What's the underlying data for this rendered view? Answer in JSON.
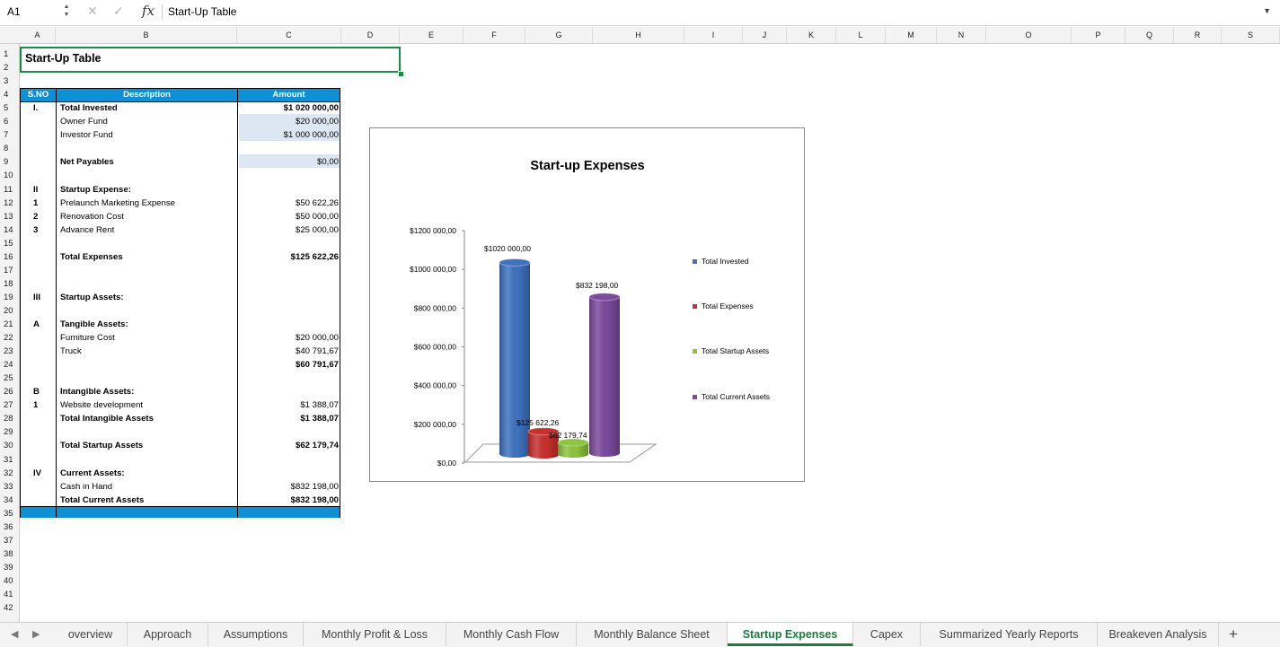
{
  "formula_bar": {
    "name_box": "A1",
    "fx": "fx",
    "formula": "Start-Up Table"
  },
  "columns": [
    "A",
    "B",
    "C",
    "D",
    "E",
    "F",
    "G",
    "H",
    "I",
    "J",
    "K",
    "L",
    "M",
    "N",
    "O",
    "P",
    "Q",
    "R",
    "S"
  ],
  "rows": [
    "1",
    "2",
    "3",
    "4",
    "5",
    "6",
    "7",
    "8",
    "9",
    "10",
    "11",
    "12",
    "13",
    "14",
    "15",
    "16",
    "17",
    "18",
    "19",
    "20",
    "21",
    "22",
    "23",
    "24",
    "25",
    "26",
    "27",
    "28",
    "29",
    "30",
    "31",
    "32",
    "33",
    "34",
    "35",
    "36",
    "37",
    "38",
    "39",
    "40",
    "41",
    "42"
  ],
  "title": "Start-Up Table",
  "table": {
    "headers": {
      "sno": "S.NO",
      "description": "Description",
      "amount": "Amount"
    },
    "rows": [
      {
        "row": 5,
        "sno": "I.",
        "desc": "Total Invested",
        "amount": "$1 020 000,00",
        "bold": true
      },
      {
        "row": 6,
        "sno": "",
        "desc": "Owner Fund",
        "amount": "$20 000,00",
        "bold": false,
        "shaded": true
      },
      {
        "row": 7,
        "sno": "",
        "desc": "Investor Fund",
        "amount": "$1 000 000,00",
        "bold": false,
        "shaded": true
      },
      {
        "row": 9,
        "sno": "",
        "desc": "Net Payables",
        "amount": "$0,00",
        "bold": true,
        "amount_bold": false,
        "shaded": true
      },
      {
        "row": 11,
        "sno": "II",
        "desc": "Startup Expense:",
        "amount": "",
        "bold": true
      },
      {
        "row": 12,
        "sno": "1",
        "desc": "Prelaunch Marketing Expense",
        "amount": "$50 622,26",
        "bold": false
      },
      {
        "row": 13,
        "sno": "2",
        "desc": "Renovation Cost",
        "amount": "$50 000,00",
        "bold": false
      },
      {
        "row": 14,
        "sno": "3",
        "desc": "Advance Rent",
        "amount": "$25 000,00",
        "bold": false
      },
      {
        "row": 16,
        "sno": "",
        "desc": "Total Expenses",
        "amount": "$125 622,26",
        "bold": true
      },
      {
        "row": 19,
        "sno": "III",
        "desc": "Startup Assets:",
        "amount": "",
        "bold": true
      },
      {
        "row": 21,
        "sno": "A",
        "desc": "Tangible Assets:",
        "amount": "",
        "bold": true
      },
      {
        "row": 22,
        "sno": "",
        "desc": "Furniture Cost",
        "amount": "$20 000,00",
        "bold": false
      },
      {
        "row": 23,
        "sno": "",
        "desc": "Truck",
        "amount": "$40 791,67",
        "bold": false
      },
      {
        "row": 24,
        "sno": "",
        "desc": "",
        "amount": "$60 791,67",
        "bold": true
      },
      {
        "row": 26,
        "sno": "B",
        "desc": "Intangible Assets:",
        "amount": "",
        "bold": true
      },
      {
        "row": 27,
        "sno": "1",
        "desc": "Website development",
        "amount": "$1 388,07",
        "bold": false
      },
      {
        "row": 28,
        "sno": "",
        "desc": "Total Intangible Assets",
        "amount": "$1 388,07",
        "bold": true
      },
      {
        "row": 30,
        "sno": "",
        "desc": "Total Startup  Assets",
        "amount": "$62 179,74",
        "bold": true
      },
      {
        "row": 32,
        "sno": "IV",
        "desc": "Current Assets:",
        "amount": "",
        "bold": true
      },
      {
        "row": 33,
        "sno": "",
        "desc": "Cash in Hand",
        "amount": "$832 198,00",
        "bold": false
      },
      {
        "row": 34,
        "sno": "",
        "desc": "Total Current Assets",
        "amount": "$832 198,00",
        "bold": true
      }
    ]
  },
  "chart_data": {
    "type": "bar",
    "title": "Start-up Expenses",
    "categories": [
      "Total Invested",
      "Total Expenses",
      "Total Startup  Assets",
      "Total Current Assets"
    ],
    "values": [
      1020000,
      125622.26,
      62179.74,
      832198
    ],
    "data_labels": [
      "$1020 000,00",
      "$125 622,26",
      "$62 179,74",
      "$832 198,00"
    ],
    "colors": [
      "#3f72c0",
      "#c8302f",
      "#8cc63f",
      "#7d4a9e"
    ],
    "ylim": [
      0,
      1200000
    ],
    "yticks": [
      0,
      200000,
      400000,
      600000,
      800000,
      1000000,
      1200000
    ],
    "ytick_labels": [
      "$0,00",
      "$200 000,00",
      "$400 000,00",
      "$600 000,00",
      "$800 000,00",
      "$1000 000,00",
      "$1200 000,00"
    ],
    "legend": "right",
    "grid": false
  },
  "tabs": [
    {
      "label": "overview"
    },
    {
      "label": "Approach"
    },
    {
      "label": "Assumptions"
    },
    {
      "label": "Monthly Profit & Loss"
    },
    {
      "label": "Monthly Cash Flow"
    },
    {
      "label": "Monthly Balance Sheet"
    },
    {
      "label": "Startup Expenses",
      "active": true
    },
    {
      "label": "Capex"
    },
    {
      "label": "Summarized Yearly Reports"
    },
    {
      "label": "Breakeven Analysis"
    }
  ]
}
